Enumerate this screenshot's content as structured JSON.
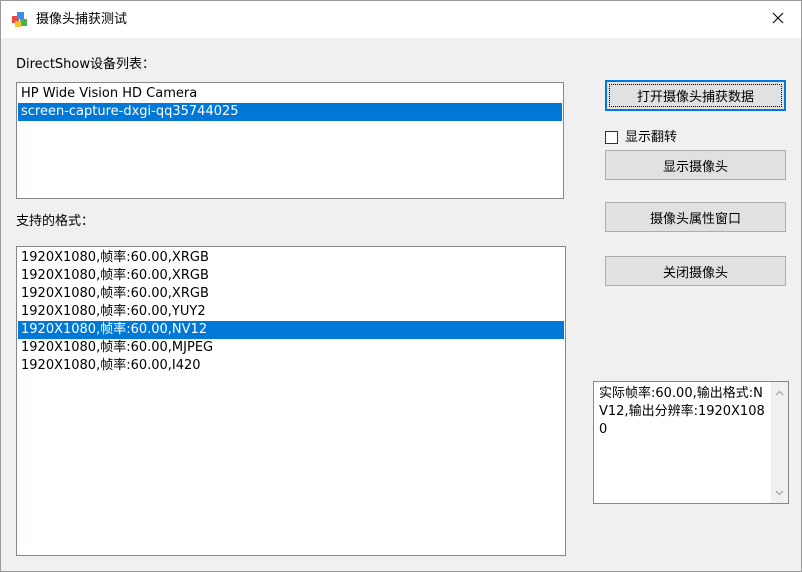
{
  "window": {
    "title": "摄像头捕获测试"
  },
  "icons": {
    "app": "app-icon",
    "close": "close-icon",
    "scroll_up": "chevron-up-icon",
    "scroll_down": "chevron-down-icon"
  },
  "devices": {
    "label": "DirectShow设备列表：",
    "items": [
      {
        "label": "HP Wide Vision HD Camera",
        "selected": false
      },
      {
        "label": "screen-capture-dxgi-qq35744025",
        "selected": true
      }
    ]
  },
  "formats": {
    "label": "支持的格式：",
    "items": [
      {
        "label": "1920X1080,帧率:60.00,XRGB",
        "selected": false
      },
      {
        "label": "1920X1080,帧率:60.00,XRGB",
        "selected": false
      },
      {
        "label": "1920X1080,帧率:60.00,XRGB",
        "selected": false
      },
      {
        "label": "1920X1080,帧率:60.00,YUY2",
        "selected": false
      },
      {
        "label": "1920X1080,帧率:60.00,NV12",
        "selected": true
      },
      {
        "label": "1920X1080,帧率:60.00,MJPEG",
        "selected": false
      },
      {
        "label": "1920X1080,帧率:60.00,I420",
        "selected": false
      }
    ]
  },
  "buttons": {
    "open_capture": "打开摄像头捕获数据",
    "show_camera": "显示摄像头",
    "properties": "摄像头属性窗口",
    "close_camera": "关闭摄像头"
  },
  "flip": {
    "label": "显示翻转",
    "checked": false
  },
  "info": {
    "text": "实际帧率:60.00,输出格式:NV12,输出分辨率:1920X1080"
  },
  "colors": {
    "selection": "#0078d7",
    "face": "#f0f0f0",
    "button": "#e1e1e1"
  }
}
